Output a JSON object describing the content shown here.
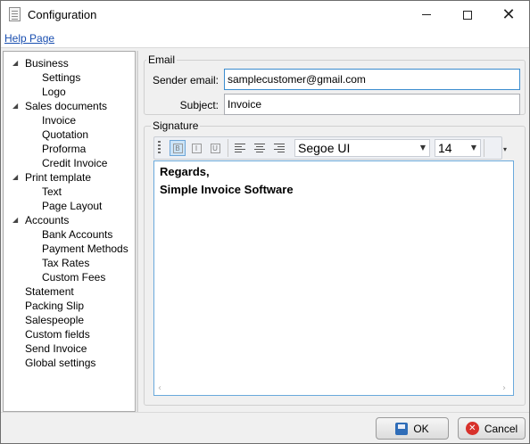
{
  "window": {
    "title": "Configuration",
    "icon": "document-icon"
  },
  "help": {
    "label": "Help Page"
  },
  "tree": {
    "items": [
      {
        "label": "Business",
        "level": 0,
        "expanded": true
      },
      {
        "label": "Settings",
        "level": 1
      },
      {
        "label": "Logo",
        "level": 1
      },
      {
        "label": "Sales documents",
        "level": 0,
        "expanded": true
      },
      {
        "label": "Invoice",
        "level": 1
      },
      {
        "label": "Quotation",
        "level": 1
      },
      {
        "label": "Proforma",
        "level": 1
      },
      {
        "label": "Credit Invoice",
        "level": 1
      },
      {
        "label": "Print template",
        "level": 0,
        "expanded": true
      },
      {
        "label": "Text",
        "level": 1
      },
      {
        "label": "Page Layout",
        "level": 1
      },
      {
        "label": "Accounts",
        "level": 0,
        "expanded": true
      },
      {
        "label": "Bank Accounts",
        "level": 1
      },
      {
        "label": "Payment Methods",
        "level": 1
      },
      {
        "label": "Tax Rates",
        "level": 1
      },
      {
        "label": "Custom Fees",
        "level": 1
      },
      {
        "label": "Statement",
        "level": 0
      },
      {
        "label": "Packing Slip",
        "level": 0
      },
      {
        "label": "Salespeople",
        "level": 0
      },
      {
        "label": "Custom fields",
        "level": 0
      },
      {
        "label": "Send Invoice",
        "level": 0,
        "selected": true
      },
      {
        "label": "Global settings",
        "level": 0
      }
    ]
  },
  "email": {
    "group_label": "Email",
    "sender_label": "Sender email:",
    "sender_value": "samplecustomer@gmail.com",
    "subject_label": "Subject:",
    "subject_value": "Invoice"
  },
  "signature": {
    "group_label": "Signature",
    "toolbar": {
      "font_family": "Segoe UI",
      "font_size": "14"
    },
    "body_lines": [
      "Regards,",
      "Simple Invoice Software"
    ]
  },
  "buttons": {
    "ok_label": "OK",
    "cancel_label": "Cancel"
  },
  "colors": {
    "link": "#1a4fb0",
    "focus_border": "#3a8ccf",
    "cancel_icon": "#d8312b"
  }
}
